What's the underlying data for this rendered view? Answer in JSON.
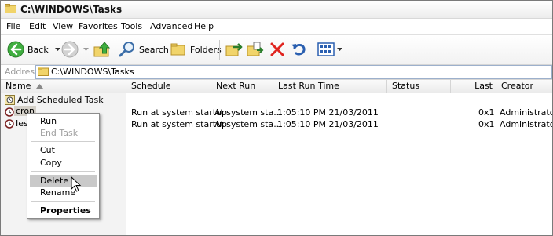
{
  "window": {
    "title": "C:\\WINDOWS\\Tasks"
  },
  "menubar": {
    "items": [
      "File",
      "Edit",
      "View",
      "Favorites",
      "Tools",
      "Advanced",
      "Help"
    ]
  },
  "toolbar": {
    "back_label": "Back",
    "search_label": "Search",
    "folders_label": "Folders"
  },
  "address": {
    "label": "Address",
    "value": "C:\\WINDOWS\\Tasks"
  },
  "columns": [
    "Name",
    "Schedule",
    "Next Run Time",
    "Last Run Time",
    "Status",
    "Last Result",
    "Creator"
  ],
  "rows": [
    {
      "name": "Add Scheduled Task",
      "schedule": "",
      "next_run": "",
      "last_run": "",
      "status": "",
      "last_result": "",
      "creator": ""
    },
    {
      "name": "cron",
      "schedule": "Run at system startup",
      "next_run": "At system sta...",
      "last_run": "1:05:10 PM  21/03/2011",
      "status": "",
      "last_result": "0x1",
      "creator": "Administrator"
    },
    {
      "name": "Ies",
      "schedule": "Run at system startup",
      "next_run": "At system sta...",
      "last_run": "1:05:10 PM  21/03/2011",
      "status": "",
      "last_result": "0x1",
      "creator": "Administrator"
    }
  ],
  "context_menu": {
    "run": "Run",
    "end_task": "End Task",
    "cut": "Cut",
    "copy": "Copy",
    "delete": "Delete",
    "rename": "Rename",
    "properties": "Properties"
  }
}
